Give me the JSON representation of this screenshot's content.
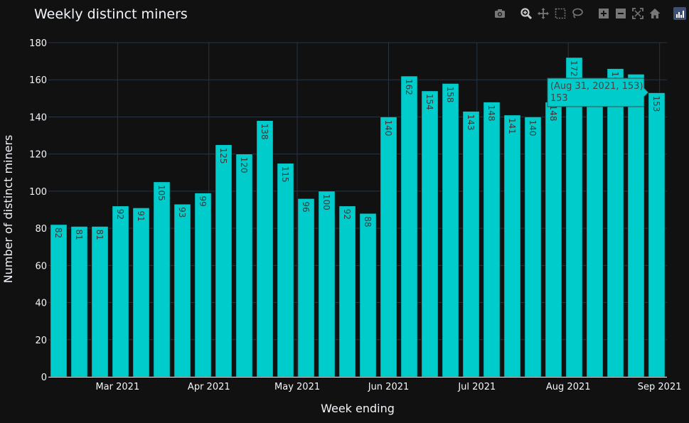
{
  "chart_data": {
    "type": "bar",
    "title": "Weekly distinct miners",
    "xlabel": "Week ending",
    "ylabel": "Number of distinct miners",
    "x": [
      "2021-02-09",
      "2021-02-16",
      "2021-02-23",
      "2021-03-02",
      "2021-03-09",
      "2021-03-16",
      "2021-03-23",
      "2021-03-30",
      "2021-04-06",
      "2021-04-13",
      "2021-04-20",
      "2021-04-27",
      "2021-05-04",
      "2021-05-11",
      "2021-05-18",
      "2021-05-25",
      "2021-06-01",
      "2021-06-08",
      "2021-06-15",
      "2021-06-22",
      "2021-06-29",
      "2021-07-06",
      "2021-07-13",
      "2021-07-20",
      "2021-07-27",
      "2021-08-03",
      "2021-08-10",
      "2021-08-17",
      "2021-08-24",
      "2021-08-31"
    ],
    "values": [
      82,
      81,
      81,
      92,
      91,
      105,
      93,
      99,
      125,
      120,
      138,
      115,
      96,
      100,
      92,
      88,
      140,
      162,
      154,
      158,
      143,
      148,
      141,
      140,
      148,
      172,
      160,
      166,
      163,
      153
    ],
    "ylim": [
      0,
      180
    ],
    "yticks": [
      0,
      20,
      40,
      60,
      80,
      100,
      120,
      140,
      160,
      180
    ],
    "xticks": [
      {
        "label": "Mar 2021",
        "date": "2021-03-01"
      },
      {
        "label": "Apr 2021",
        "date": "2021-04-01"
      },
      {
        "label": "May 2021",
        "date": "2021-05-01"
      },
      {
        "label": "Jun 2021",
        "date": "2021-06-01"
      },
      {
        "label": "Jul 2021",
        "date": "2021-07-01"
      },
      {
        "label": "Aug 2021",
        "date": "2021-08-01"
      },
      {
        "label": "Sep 2021",
        "date": "2021-09-01"
      }
    ],
    "grid": true,
    "bar_color": "#00cccc",
    "hover": {
      "index": 29,
      "line1": "(Aug 31, 2021, 153)",
      "line2": "153"
    }
  },
  "modebar": {
    "icons": [
      "camera-icon",
      "zoom-icon",
      "pan-icon",
      "box-select-icon",
      "lasso-select-icon",
      "zoom-in-icon",
      "zoom-out-icon",
      "autoscale-icon",
      "reset-axes-icon",
      "plotly-logo-icon"
    ]
  },
  "colors": {
    "background": "#111111",
    "grid": "#283442",
    "bar": "#00cccc",
    "text": "#f2f5fa"
  }
}
